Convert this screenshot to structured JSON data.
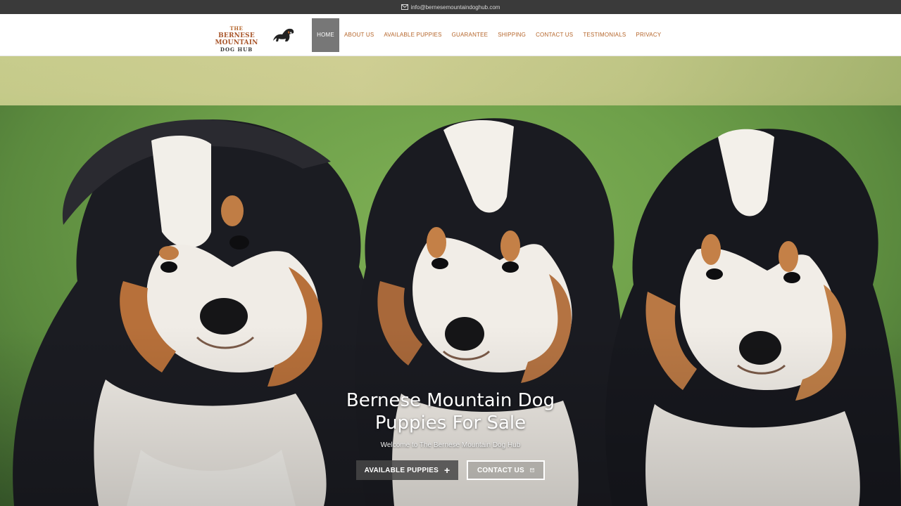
{
  "topbar": {
    "email": "info@bernesemountaindoghub.com",
    "icon": "mail-icon"
  },
  "logo": {
    "line1": "THE",
    "line2": "BERNESE MOUNTAIN",
    "line3": "DOG HUB",
    "icon": "dog-silhouette-icon"
  },
  "nav": {
    "items": [
      {
        "label": "HOME",
        "active": true
      },
      {
        "label": "ABOUT US"
      },
      {
        "label": "AVAILABLE PUPPIES"
      },
      {
        "label": "GUARANTEE"
      },
      {
        "label": "SHIPPING"
      },
      {
        "label": "CONTACT US"
      },
      {
        "label": "TESTIMONIALS"
      },
      {
        "label": "PRIVACY"
      }
    ]
  },
  "hero": {
    "title_line1": "Bernese Mountain Dog",
    "title_line2": "Puppies For Sale",
    "subtitle": "Welcome to The Bernese Mountain Dog Hub",
    "buttons": {
      "available_puppies": "AVAILABLE PUPPIES",
      "available_puppies_icon": "+",
      "contact_us": "CONTACT US"
    }
  },
  "colors": {
    "accent": "#b5652a",
    "topbar_bg": "#3a3a3a",
    "nav_active_bg": "#777777"
  }
}
